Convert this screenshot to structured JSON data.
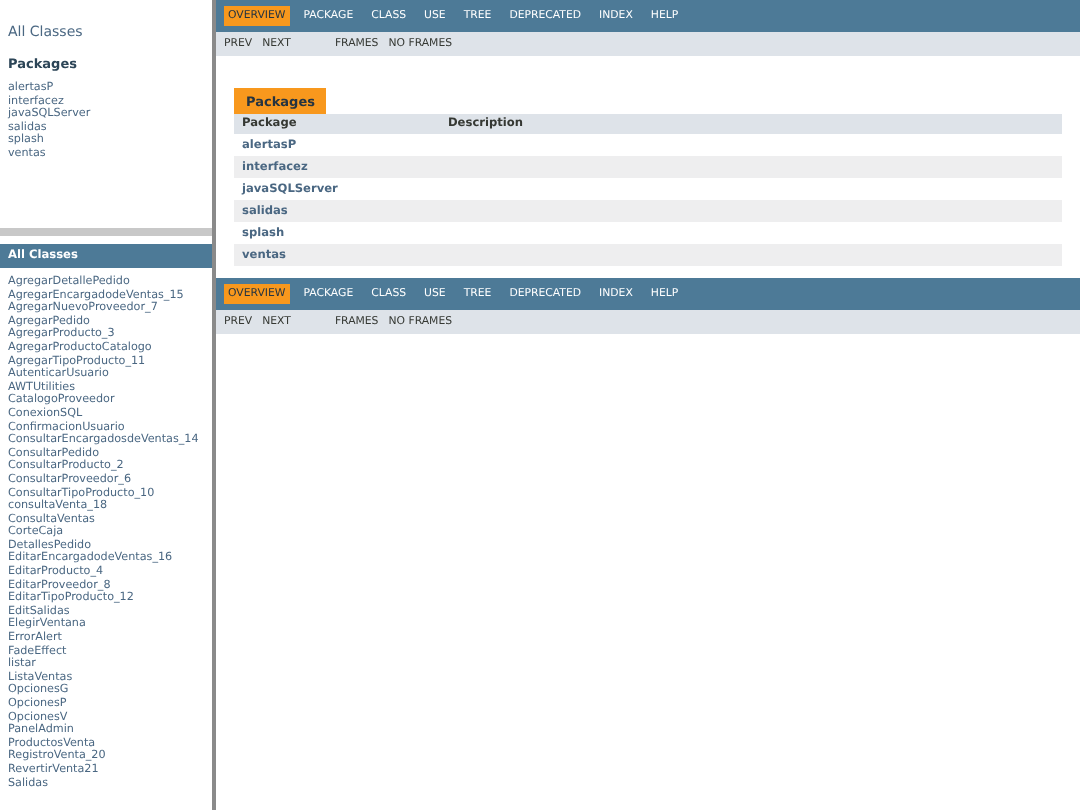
{
  "package_frame": {
    "all_classes_link": "All Classes",
    "heading": "Packages",
    "packages": [
      "alertasP",
      "interfacez",
      "javaSQLServer",
      "salidas",
      "splash",
      "ventas"
    ]
  },
  "class_frame": {
    "heading": "All Classes",
    "classes": [
      "AgregarDetallePedido",
      "AgregarEncargadodeVentas_15",
      "AgregarNuevoProveedor_7",
      "AgregarPedido",
      "AgregarProducto_3",
      "AgregarProductoCatalogo",
      "AgregarTipoProducto_11",
      "AutenticarUsuario",
      "AWTUtilities",
      "CatalogoProveedor",
      "ConexionSQL",
      "ConfirmacionUsuario",
      "ConsultarEncargadosdeVentas_14",
      "ConsultarPedido",
      "ConsultarProducto_2",
      "ConsultarProveedor_6",
      "ConsultarTipoProducto_10",
      "consultaVenta_18",
      "ConsultaVentas",
      "CorteCaja",
      "DetallesPedido",
      "EditarEncargadodeVentas_16",
      "EditarProducto_4",
      "EditarProveedor_8",
      "EditarTipoProducto_12",
      "EditSalidas",
      "ElegirVentana",
      "ErrorAlert",
      "FadeEffect",
      "listar",
      "ListaVentas",
      "OpcionesG",
      "OpcionesP",
      "OpcionesV",
      "PanelAdmin",
      "ProductosVenta",
      "RegistroVenta_20",
      "RevertirVenta21",
      "Salidas"
    ]
  },
  "top_nav": {
    "items": [
      {
        "label": "OVERVIEW",
        "selected": true
      },
      {
        "label": "PACKAGE",
        "selected": false
      },
      {
        "label": "CLASS",
        "selected": false
      },
      {
        "label": "USE",
        "selected": false
      },
      {
        "label": "TREE",
        "selected": false
      },
      {
        "label": "DEPRECATED",
        "selected": false
      },
      {
        "label": "INDEX",
        "selected": false
      },
      {
        "label": "HELP",
        "selected": false
      }
    ],
    "sub_left": [
      "PREV",
      "NEXT"
    ],
    "sub_right": [
      "FRAMES",
      "NO FRAMES"
    ]
  },
  "packages_table": {
    "caption": "Packages",
    "columns": [
      "Package",
      "Description"
    ],
    "rows": [
      "alertasP",
      "interfacez",
      "javaSQLServer",
      "salidas",
      "splash",
      "ventas"
    ]
  },
  "bottom_nav": {
    "items": [
      {
        "label": "OVERVIEW",
        "selected": true
      },
      {
        "label": "PACKAGE",
        "selected": false
      },
      {
        "label": "CLASS",
        "selected": false
      },
      {
        "label": "USE",
        "selected": false
      },
      {
        "label": "TREE",
        "selected": false
      },
      {
        "label": "DEPRECATED",
        "selected": false
      },
      {
        "label": "INDEX",
        "selected": false
      },
      {
        "label": "HELP",
        "selected": false
      }
    ],
    "sub_left": [
      "PREV",
      "NEXT"
    ],
    "sub_right": [
      "FRAMES",
      "NO FRAMES"
    ]
  }
}
